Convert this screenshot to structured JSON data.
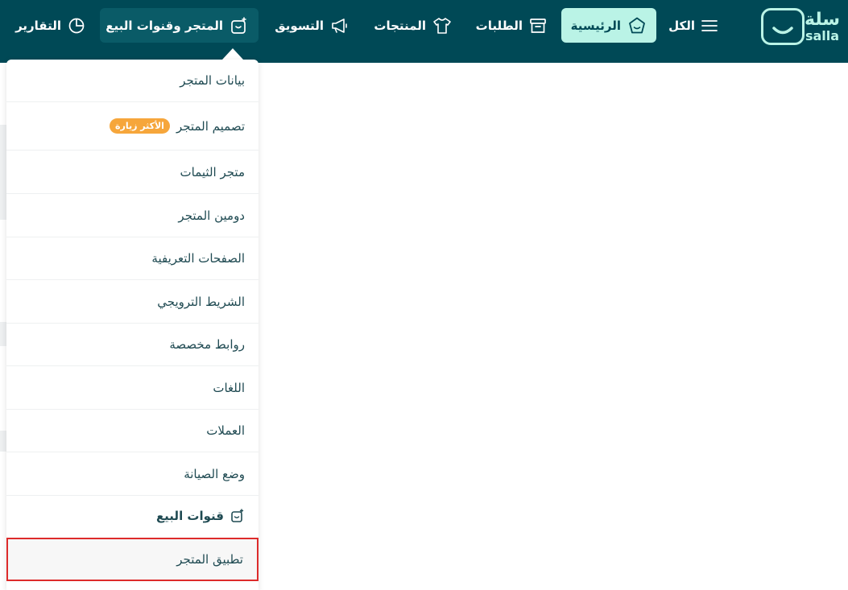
{
  "brand": {
    "name_ar": "سلة",
    "name_en": "salla"
  },
  "nav": {
    "all": "الكل",
    "home": "الرئيسية",
    "orders": "الطلبات",
    "products": "المنتجات",
    "marketing": "التسويق",
    "store_channels": "المتجر وقنوات البيع",
    "reports": "التقارير"
  },
  "dropdown": {
    "items": [
      {
        "label": "بيانات المتجر"
      },
      {
        "label": "تصميم المتجر",
        "badge": "الأكثر زيارة"
      },
      {
        "label": "متجر الثيمات"
      },
      {
        "label": "دومين المتجر"
      },
      {
        "label": "الصفحات التعريفية"
      },
      {
        "label": "الشريط الترويجي"
      },
      {
        "label": "روابط مخصصة"
      },
      {
        "label": "اللغات"
      },
      {
        "label": "العملات"
      },
      {
        "label": "وضع الصيانة"
      }
    ],
    "section_header": "قنوات البيع",
    "active_item": "تطبيق المتجر"
  },
  "colors": {
    "topbar": "#004956",
    "home_highlight": "#baf3e6",
    "badge": "#f6a63b",
    "active_border": "#dd2b2b"
  }
}
